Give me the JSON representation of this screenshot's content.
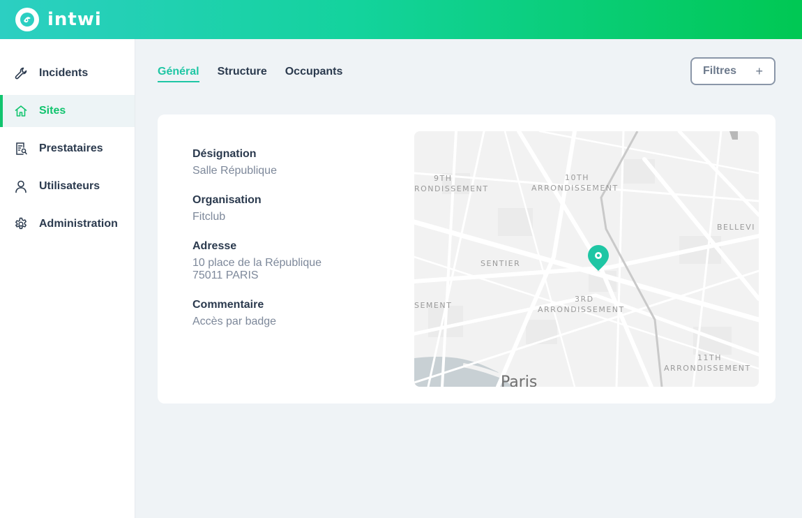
{
  "brand": {
    "name": "intwi"
  },
  "colors": {
    "accent": "#11c46e",
    "tab_accent": "#1fc6a4",
    "pin": "#1fc6a4"
  },
  "sidebar": {
    "items": [
      {
        "label": "Incidents",
        "icon": "wrench-icon"
      },
      {
        "label": "Sites",
        "icon": "home-icon",
        "active": true
      },
      {
        "label": "Prestataires",
        "icon": "document-search-icon"
      },
      {
        "label": "Utilisateurs",
        "icon": "user-icon"
      },
      {
        "label": "Administration",
        "icon": "gear-icon"
      }
    ]
  },
  "tabs": [
    {
      "label": "Général",
      "active": true
    },
    {
      "label": "Structure"
    },
    {
      "label": "Occupants"
    }
  ],
  "filter": {
    "label": "Filtres",
    "icon": "plus-icon"
  },
  "site": {
    "designation_label": "Désignation",
    "designation": "Salle République",
    "organisation_label": "Organisation",
    "organisation": "Fitclub",
    "adresse_label": "Adresse",
    "adresse_line1": "10 place de la République",
    "adresse_line2": "75011 PARIS",
    "commentaire_label": "Commentaire",
    "commentaire": "Accès par badge"
  },
  "map": {
    "labels": {
      "l9_a": "9TH",
      "l9_b": "RONDISSEMENT",
      "l10_a": "10TH",
      "l10_b": "ARRONDISSEMENT",
      "belleville": "BELLEVI",
      "sentier": "SENTIER",
      "l3_a": "3RD",
      "l3_b": "ARRONDISSEMENT",
      "l2": "SEMENT",
      "l11_a": "11TH",
      "l11_b": "ARRONDISSEMENT",
      "paris": "Paris"
    },
    "marker_icon": "location-pin-icon"
  }
}
